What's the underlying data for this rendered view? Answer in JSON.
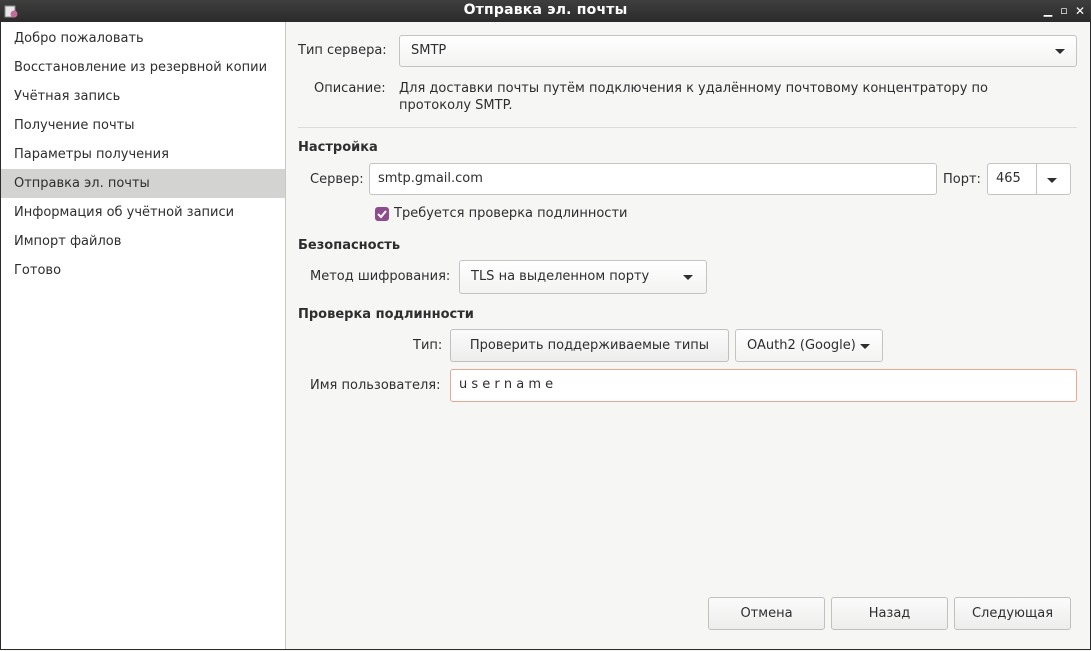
{
  "window": {
    "title": "Отправка эл. почты"
  },
  "sidebar": {
    "items": [
      {
        "label": "Добро пожаловать"
      },
      {
        "label": "Восстановление из резервной копии"
      },
      {
        "label": "Учётная запись"
      },
      {
        "label": "Получение почты"
      },
      {
        "label": "Параметры получения"
      },
      {
        "label": "Отправка эл. почты"
      },
      {
        "label": "Информация об учётной записи"
      },
      {
        "label": "Импорт файлов"
      },
      {
        "label": "Готово"
      }
    ],
    "active_index": 5
  },
  "server_type": {
    "label": "Тип сервера:",
    "value": "SMTP",
    "description_label": "Описание:",
    "description": "Для доставки почты путём подключения к удалённому почтовому концентратору по протоколу SMTP."
  },
  "settings": {
    "heading": "Настройка",
    "server_label": "Сервер:",
    "server_value": "smtp.gmail.com",
    "port_label": "Порт:",
    "port_value": "465",
    "auth_required_label": "Требуется проверка подлинности",
    "auth_required_checked": true
  },
  "security": {
    "heading": "Безопасность",
    "encryption_label": "Метод шифрования:",
    "encryption_value": "TLS на выделенном порту"
  },
  "authentication": {
    "heading": "Проверка подлинности",
    "type_label": "Тип:",
    "check_types_button": "Проверить поддерживаемые типы",
    "type_value": "OAuth2 (Google)",
    "username_label": "Имя пользователя:",
    "username_value": "u s e r n a m e"
  },
  "buttons": {
    "cancel": "Отмена",
    "back": "Назад",
    "next": "Следующая"
  },
  "colors": {
    "accent_check": "#8f4c8c",
    "focus_border": "#e8a896",
    "selected_row": "#d3d3d1"
  }
}
